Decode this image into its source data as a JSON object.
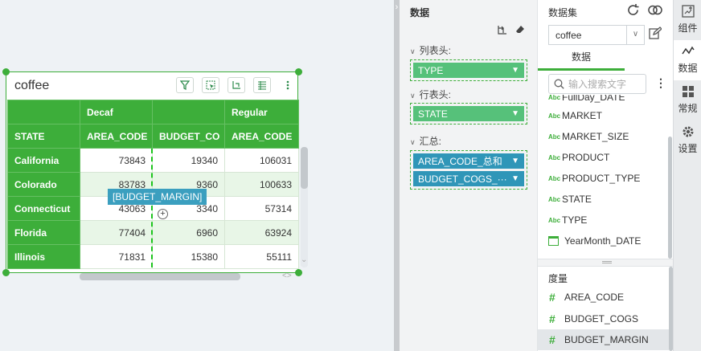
{
  "widget": {
    "title": "coffee",
    "tools": [
      "filter-icon",
      "select-icon",
      "axis-icon",
      "table-settings-icon",
      "more-icon"
    ]
  },
  "table": {
    "group_header_row": [
      "",
      "Decaf",
      "",
      "Regular"
    ],
    "column_header_row": [
      "STATE",
      "AREA_CODE",
      "BUDGET_CO",
      "AREA_CODE"
    ],
    "rows": [
      {
        "state": "California",
        "values": [
          "73843",
          "19340",
          "106031"
        ]
      },
      {
        "state": "Colorado",
        "values": [
          "83783",
          "9360",
          "100633"
        ]
      },
      {
        "state": "Connecticut",
        "values": [
          "43063",
          "3340",
          "57314"
        ]
      },
      {
        "state": "Florida",
        "values": [
          "77404",
          "6960",
          "63924"
        ]
      },
      {
        "state": "Illinois",
        "values": [
          "71831",
          "15380",
          "55111"
        ]
      }
    ]
  },
  "drag": {
    "tooltip": "[BUDGET_MARGIN]",
    "plus": "+"
  },
  "data_panel": {
    "title": "数据",
    "sections": [
      {
        "label": "列表头:",
        "pills": [
          {
            "text": "TYPE",
            "style": "green"
          }
        ]
      },
      {
        "label": "行表头:",
        "pills": [
          {
            "text": "STATE",
            "style": "green"
          }
        ]
      },
      {
        "label": "汇总:",
        "pills": [
          {
            "text": "AREA_CODE_总和",
            "style": "blue"
          },
          {
            "text": "BUDGET_COGS_···",
            "style": "blue"
          }
        ]
      }
    ]
  },
  "dataset_panel": {
    "title": "数据集",
    "selected_dataset": "coffee",
    "tab": "数据",
    "search_placeholder": "输入搜索文字",
    "dimension_badge": "Abc",
    "dimensions": [
      {
        "name": "FullDay_DATE",
        "icon": "abc"
      },
      {
        "name": "MARKET",
        "icon": "abc"
      },
      {
        "name": "MARKET_SIZE",
        "icon": "abc"
      },
      {
        "name": "PRODUCT",
        "icon": "abc"
      },
      {
        "name": "PRODUCT_TYPE",
        "icon": "abc"
      },
      {
        "name": "STATE",
        "icon": "abc"
      },
      {
        "name": "TYPE",
        "icon": "abc"
      },
      {
        "name": "YearMonth_DATE",
        "icon": "calendar"
      }
    ],
    "measure_label": "度量",
    "measures": [
      {
        "name": "AREA_CODE",
        "selected": false
      },
      {
        "name": "BUDGET_COGS",
        "selected": false
      },
      {
        "name": "BUDGET_MARGIN",
        "selected": true
      }
    ]
  },
  "rail": {
    "items": [
      {
        "label": "组件",
        "icon": "add-widget-icon"
      },
      {
        "label": "数据",
        "icon": "data-line-icon"
      },
      {
        "label": "常规",
        "icon": "grid-icon"
      },
      {
        "label": "设置",
        "icon": "gear-icon"
      }
    ]
  },
  "colors": {
    "accent": "#3dae3a",
    "pill_green": "#56c17a",
    "pill_blue": "#2f96b8",
    "tooltip": "#3b9fbf"
  }
}
